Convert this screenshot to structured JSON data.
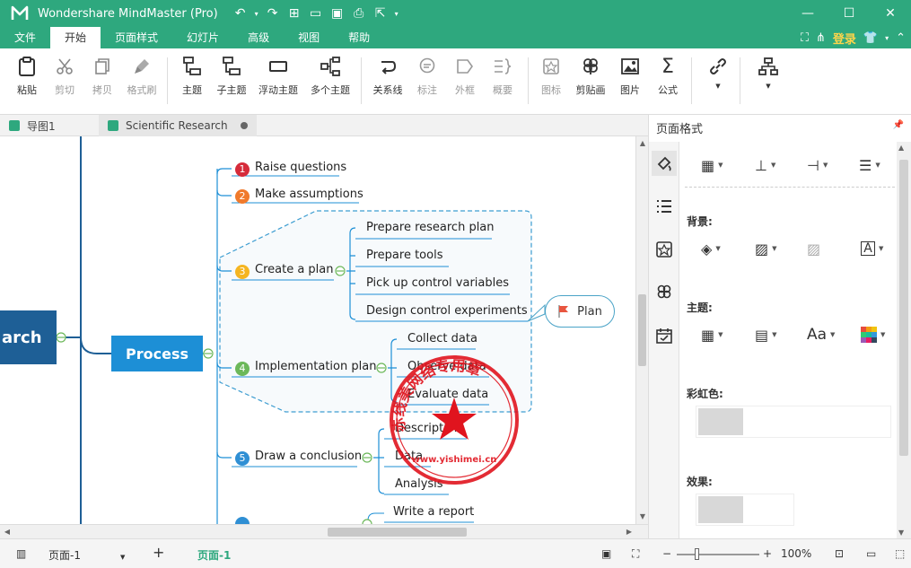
{
  "app": {
    "title": "Wondershare MindMaster (Pro)",
    "accent": "#2ea87e"
  },
  "menu": {
    "tabs": [
      "文件",
      "开始",
      "页面样式",
      "幻灯片",
      "高级",
      "视图",
      "帮助"
    ],
    "active": "开始",
    "login": "登录"
  },
  "ribbon": {
    "paste": "粘贴",
    "cut": "剪切",
    "copy": "拷贝",
    "format_painter": "格式刷",
    "topic": "主题",
    "subtopic": "子主题",
    "floating_topic": "浮动主题",
    "multi_topic": "多个主题",
    "relation": "关系线",
    "callout": "标注",
    "boundary": "外框",
    "summary": "概要",
    "icon": "图标",
    "clipart": "剪贴画",
    "image": "图片",
    "formula": "公式"
  },
  "doctabs": {
    "tab1": "导图1",
    "tab2": "Scientific Research"
  },
  "mindmap": {
    "root": "arch",
    "process": "Process",
    "branches": [
      {
        "num": "1",
        "label": "Raise questions",
        "color": "#d62b3a"
      },
      {
        "num": "2",
        "label": "Make assumptions",
        "color": "#f07a2c"
      },
      {
        "num": "3",
        "label": "Create a plan",
        "color": "#f5b521"
      },
      {
        "num": "4",
        "label": "Implementation plan",
        "color": "#6cb85a"
      },
      {
        "num": "5",
        "label": "Draw a conclusion",
        "color": "#2f8fd4"
      }
    ],
    "plan_subs": [
      "Prepare research plan",
      "Prepare tools",
      "Pick up control variables",
      "Design control experiments"
    ],
    "impl_subs": [
      "Collect data",
      "Observe data",
      "Evaluate data"
    ],
    "conclusion_subs": [
      "Description",
      "Data",
      "Analysis"
    ],
    "report_sub": "Write a report",
    "plan_callout": "Plan"
  },
  "stamp": {
    "ring_text": "赤 线 美 网 络 专 用 章",
    "bottom_text": "www.yishimei.cn"
  },
  "panel": {
    "title": "页面格式",
    "background": "背景:",
    "theme": "主题:",
    "rainbow": "彩虹色:",
    "effect": "效果:",
    "font_icon": "Aa"
  },
  "status": {
    "page_select": "页面-1",
    "active_page": "页面-1",
    "zoom": "100%"
  }
}
